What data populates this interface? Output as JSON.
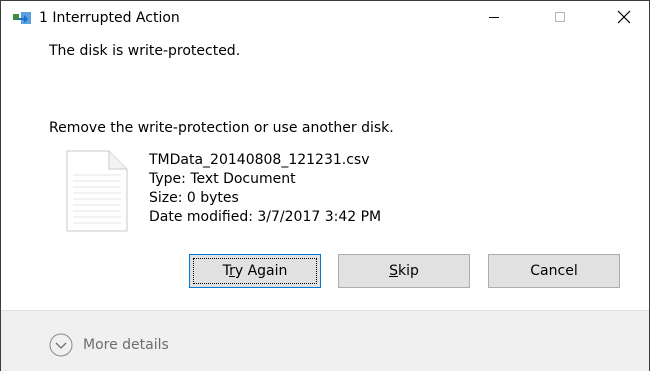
{
  "window": {
    "title": "1 Interrupted Action"
  },
  "message": {
    "line1": "The disk is write-protected.",
    "line2": "Remove the write-protection or use another disk."
  },
  "file": {
    "name": "TMData_20140808_121231.csv",
    "type": "Type: Text Document",
    "size": "Size: 0 bytes",
    "modified": "Date modified: 3/7/2017 3:42 PM"
  },
  "buttons": {
    "try_again": {
      "pre": "T",
      "accel": "r",
      "post": "y Again"
    },
    "skip": {
      "pre": "",
      "accel": "S",
      "post": "kip"
    },
    "cancel": "Cancel"
  },
  "footer": {
    "more_details": "More details"
  },
  "icons": {
    "app": "file-transfer-icon",
    "minimize": "minimize-icon",
    "maximize": "maximize-icon",
    "close": "close-icon",
    "file": "text-document-icon",
    "expand": "chevron-down-circle-icon"
  },
  "colors": {
    "focus_border": "#0078d7",
    "button_bg": "#e1e1e1",
    "footer_bg": "#f0f0f0"
  }
}
